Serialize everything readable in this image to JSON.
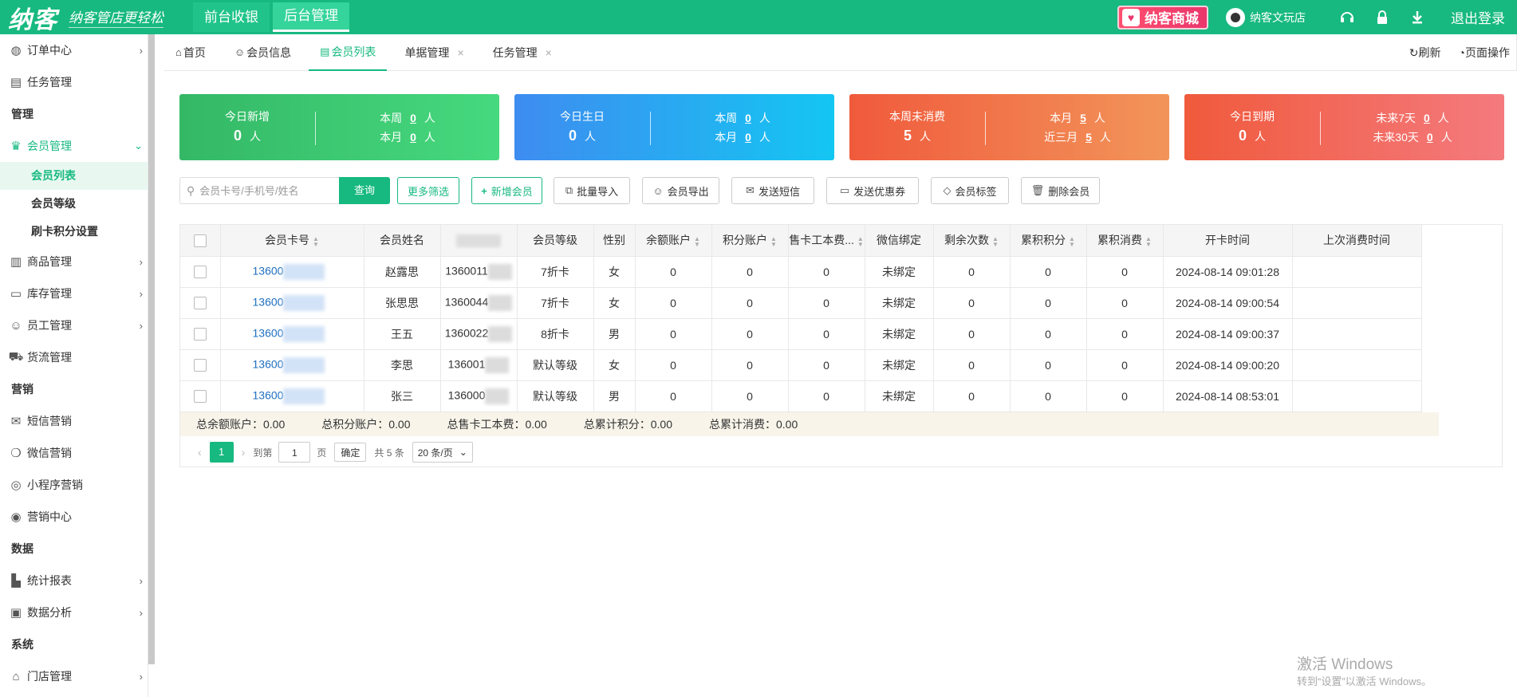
{
  "brand": {
    "logo": "纳客",
    "slogan": "纳客管店更轻松"
  },
  "top_tabs": [
    "前台收银",
    "后台管理"
  ],
  "top_right": {
    "mall": "纳客商城",
    "user": "纳客文玩店",
    "logout": "退出登录"
  },
  "sidebar": {
    "items": [
      {
        "label": "订单中心",
        "icon": "globe-icon",
        "arrow": true
      },
      {
        "label": "任务管理",
        "icon": "task-icon",
        "arrow": false
      }
    ],
    "group_manage": "管理",
    "member_mgmt": "会员管理",
    "member_subs": [
      "会员列表",
      "会员等级",
      "刷卡积分设置"
    ],
    "items2": [
      {
        "label": "商品管理",
        "icon": "goods-icon",
        "arrow": true
      },
      {
        "label": "库存管理",
        "icon": "warehouse-icon",
        "arrow": true
      },
      {
        "label": "员工管理",
        "icon": "user-icon",
        "arrow": true
      },
      {
        "label": "货流管理",
        "icon": "truck-icon",
        "arrow": false
      }
    ],
    "group_marketing": "营销",
    "items3": [
      {
        "label": "短信营销",
        "icon": "mail-icon"
      },
      {
        "label": "微信营销",
        "icon": "wechat-icon"
      },
      {
        "label": "小程序营销",
        "icon": "miniprogram-icon"
      },
      {
        "label": "营销中心",
        "icon": "target-icon"
      }
    ],
    "group_data": "数据",
    "items4": [
      {
        "label": "统计报表",
        "icon": "bar-chart-icon"
      },
      {
        "label": "数据分析",
        "icon": "monitor-chart-icon"
      }
    ],
    "group_system": "系统",
    "items5": [
      {
        "label": "门店管理",
        "icon": "store-icon"
      }
    ]
  },
  "page_tabs": [
    {
      "label": "首页",
      "icon": "home-icon"
    },
    {
      "label": "会员信息",
      "icon": "user-icon"
    },
    {
      "label": "会员列表",
      "icon": "list-icon"
    },
    {
      "label": "单据管理"
    },
    {
      "label": "任务管理"
    }
  ],
  "tabs_right": {
    "refresh": "刷新",
    "page_ops": "页面操作"
  },
  "cards": [
    {
      "title": "今日新增",
      "value": "0",
      "unit": "人",
      "r1_label": "本周",
      "r1_value": "0",
      "r2_label": "本月",
      "r2_value": "0",
      "gradient": [
        "#34b866",
        "#46d97e"
      ]
    },
    {
      "title": "今日生日",
      "value": "0",
      "unit": "人",
      "r1_label": "本周",
      "r1_value": "0",
      "r2_label": "本月",
      "r2_value": "0",
      "gradient": [
        "#3e8cf0",
        "#14c6f2"
      ]
    },
    {
      "title": "本周未消费",
      "value": "5",
      "unit": "人",
      "r1_label": "本月",
      "r1_value": "5",
      "r2_label": "近三月",
      "r2_value": "5",
      "gradient": [
        "#f05a3c",
        "#f2955a"
      ]
    },
    {
      "title": "今日到期",
      "value": "0",
      "unit": "人",
      "r1_label": "未来7天",
      "r1_value": "0",
      "r2_label": "未来30天",
      "r2_value": "0",
      "gradient": [
        "#f05a3c",
        "#f47a7e"
      ]
    }
  ],
  "toolbar": {
    "search_placeholder": "会员卡号/手机号/姓名",
    "query": "查询",
    "more_filter": "更多筛选",
    "add_member": "新增会员",
    "batch_import": "批量导入",
    "export": "会员导出",
    "send_sms": "发送短信",
    "send_coupon": "发送优惠券",
    "tags": "会员标签",
    "delete": "删除会员"
  },
  "table": {
    "headers": [
      "会员卡号",
      "会员姓名",
      "",
      "会员等级",
      "性别",
      "余额账户",
      "积分账户",
      "售卡工本费...",
      "微信绑定",
      "剩余次数",
      "累积积分",
      "累积消费",
      "开卡时间",
      "上次消费时间"
    ],
    "rows": [
      {
        "card": "13600",
        "name": "赵露思",
        "phone": "1360011",
        "level": "7折卡",
        "gender": "女",
        "balance": "0",
        "points": "0",
        "fee": "0",
        "wechat": "未绑定",
        "times": "0",
        "acc_points": "0",
        "acc_spend": "0",
        "open_time": "2024-08-14 09:01:28",
        "last": ""
      },
      {
        "card": "13600",
        "name": "张思思",
        "phone": "1360044",
        "level": "7折卡",
        "gender": "女",
        "balance": "0",
        "points": "0",
        "fee": "0",
        "wechat": "未绑定",
        "times": "0",
        "acc_points": "0",
        "acc_spend": "0",
        "open_time": "2024-08-14 09:00:54",
        "last": ""
      },
      {
        "card": "13600",
        "name": "王五",
        "phone": "1360022",
        "level": "8折卡",
        "gender": "男",
        "balance": "0",
        "points": "0",
        "fee": "0",
        "wechat": "未绑定",
        "times": "0",
        "acc_points": "0",
        "acc_spend": "0",
        "open_time": "2024-08-14 09:00:37",
        "last": ""
      },
      {
        "card": "13600",
        "name": "李思",
        "phone": "136001",
        "level": "默认等级",
        "gender": "女",
        "balance": "0",
        "points": "0",
        "fee": "0",
        "wechat": "未绑定",
        "times": "0",
        "acc_points": "0",
        "acc_spend": "0",
        "open_time": "2024-08-14 09:00:20",
        "last": ""
      },
      {
        "card": "13600",
        "name": "张三",
        "phone": "136000",
        "level": "默认等级",
        "gender": "男",
        "balance": "0",
        "points": "0",
        "fee": "0",
        "wechat": "未绑定",
        "times": "0",
        "acc_points": "0",
        "acc_spend": "0",
        "open_time": "2024-08-14 08:53:01",
        "last": ""
      }
    ],
    "summary": [
      "总余额账户：0.00",
      "总积分账户：0.00",
      "总售卡工本费：0.00",
      "总累计积分：0.00",
      "总累计消费：0.00"
    ]
  },
  "pager": {
    "page": "1",
    "goto": "到第",
    "input": "1",
    "page_unit": "页",
    "ok": "确定",
    "total": "共 5 条",
    "size": "20 条/页"
  },
  "watermark": {
    "line1": "激活 Windows",
    "line2": "转到“设置”以激活 Windows。"
  }
}
